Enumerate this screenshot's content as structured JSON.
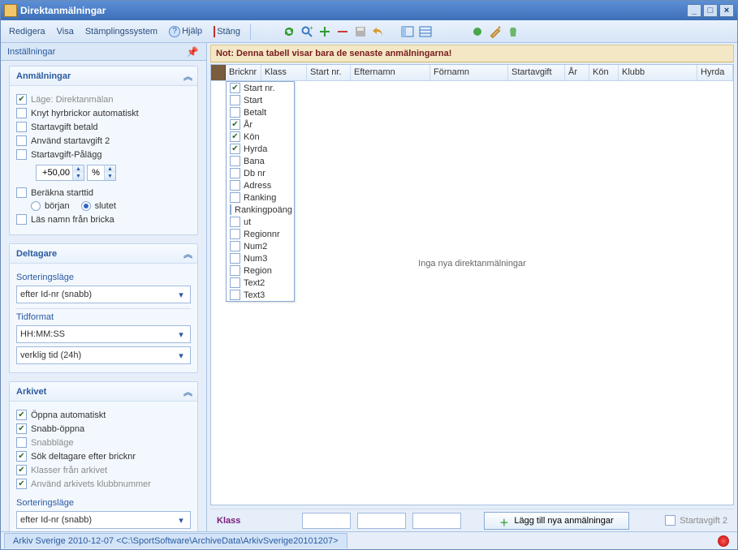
{
  "window": {
    "title": "Direktanmälningar"
  },
  "menu": {
    "redigera": "Redigera",
    "visa": "Visa",
    "stamplings": "Stämplingssystem",
    "hjalp": "Hjälp",
    "stang": "Stäng"
  },
  "left": {
    "header": "Inställningar",
    "anmalningar": {
      "title": "Anmälningar",
      "lage": "Läge: Direktanmälan",
      "knyt": "Knyt hyrbrickor automatiskt",
      "startavgift_betald": "Startavgift betald",
      "anvand_s2": "Använd startavgift 2",
      "palagg": "Startavgift-Pålägg",
      "spin_val": "+50,00",
      "spin_unit": "%",
      "berakna": "Beräkna starttid",
      "borjan": "början",
      "slutet": "slutet",
      "lasnamn": "Läs namn från bricka"
    },
    "deltagare": {
      "title": "Deltagare",
      "sort_label": "Sorteringsläge",
      "sort_value": "efter Id-nr (snabb)",
      "tid_label": "Tidformat",
      "tid_fmt": "HH:MM:SS",
      "tid_realtime": "verklig tid (24h)"
    },
    "arkivet": {
      "title": "Arkivet",
      "oppna": "Öppna automatiskt",
      "snabb": "Snabb-öppna",
      "snabblage": "Snabbläge",
      "sok": "Sök deltagare efter bricknr",
      "klasser": "Klasser från arkivet",
      "anvand_klubb": "Använd arkivets klubbnummer",
      "sort_label": "Sorteringsläge",
      "sort_value": "efter Id-nr (snabb)"
    }
  },
  "right": {
    "notice": "Not: Denna tabell visar bara de senaste anmälningarna!",
    "columns": {
      "bricknr": "Bricknr",
      "klass": "Klass",
      "startnr": "Start nr.",
      "efternamn": "Efternamn",
      "fornamn": "Förnamn",
      "startavgift": "Startavgift",
      "ar": "År",
      "kon": "Kön",
      "klubb": "Klubb",
      "hyrda": "Hyrda"
    },
    "column_picker": [
      {
        "label": "Start nr.",
        "checked": true
      },
      {
        "label": "Start",
        "checked": false
      },
      {
        "label": "Betalt",
        "checked": false
      },
      {
        "label": "År",
        "checked": true
      },
      {
        "label": "Kön",
        "checked": true
      },
      {
        "label": "Hyrda",
        "checked": true
      },
      {
        "label": "Bana",
        "checked": false
      },
      {
        "label": "Db nr",
        "checked": false
      },
      {
        "label": "Adress",
        "checked": false
      },
      {
        "label": "Ranking",
        "checked": false
      },
      {
        "label": "Rankingpoäng",
        "checked": false
      },
      {
        "label": "ut",
        "checked": false
      },
      {
        "label": "Regionnr",
        "checked": false
      },
      {
        "label": "Num2",
        "checked": false
      },
      {
        "label": "Num3",
        "checked": false
      },
      {
        "label": "Region",
        "checked": false
      },
      {
        "label": "Text2",
        "checked": false
      },
      {
        "label": "Text3",
        "checked": false
      }
    ],
    "empty": "Inga nya direktanmälningar",
    "footer": {
      "klass": "Klass",
      "addbtn": "Lägg till nya anmälningar",
      "startavgift2": "Startavgift 2"
    }
  },
  "status": {
    "tab": "Arkiv Sverige  2010-12-07  <C:\\SportSoftware\\ArchiveData\\ArkivSverige20101207>"
  }
}
